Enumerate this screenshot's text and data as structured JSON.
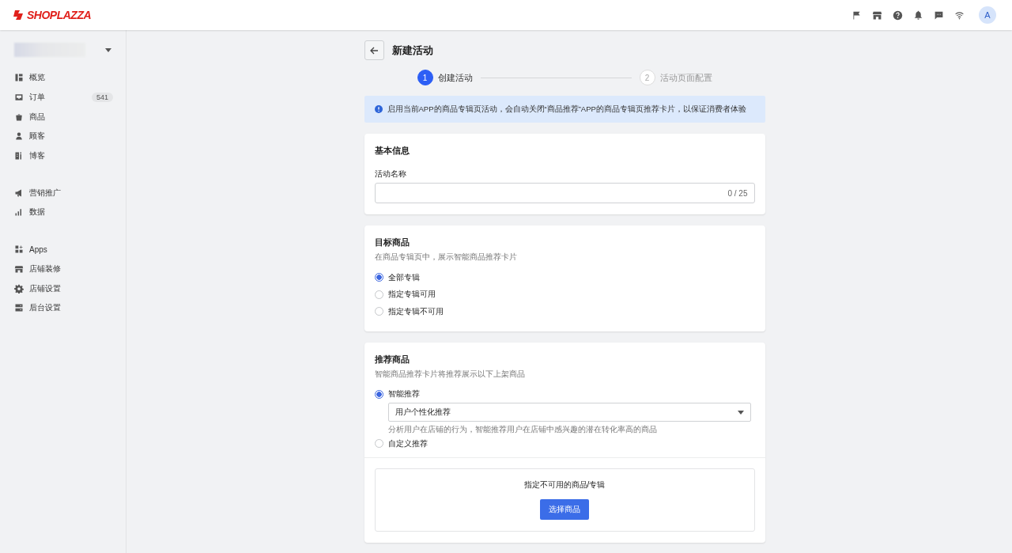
{
  "header": {
    "logo": "SHOPLAZZA",
    "avatar": "A"
  },
  "sidebar": {
    "groups": [
      [
        {
          "label": "概览"
        },
        {
          "label": "订单",
          "badge": "541"
        },
        {
          "label": "商品"
        },
        {
          "label": "顾客"
        },
        {
          "label": "博客"
        }
      ],
      [
        {
          "label": "营销推广"
        },
        {
          "label": "数据"
        }
      ],
      [
        {
          "label": "Apps"
        },
        {
          "label": "店铺装修"
        },
        {
          "label": "店铺设置"
        },
        {
          "label": "后台设置"
        }
      ]
    ]
  },
  "page": {
    "title": "新建活动",
    "steps": [
      {
        "number": "1",
        "label": "创建活动",
        "selected": true
      },
      {
        "number": "2",
        "label": "活动页面配置",
        "selected": false
      }
    ],
    "notice": "启用当前APP的商品专辑页活动，会自动关闭“商品推荐”APP的商品专辑页推荐卡片，以保证消费者体验",
    "basic": {
      "title": "基本信息",
      "field_label": "活动名称",
      "counter": "0 / 25"
    },
    "target": {
      "title": "目标商品",
      "subtitle": "在商品专辑页中，展示智能商品推荐卡片",
      "options": [
        {
          "label": "全部专辑",
          "selected": true
        },
        {
          "label": "指定专辑可用",
          "selected": false
        },
        {
          "label": "指定专辑不可用",
          "selected": false
        }
      ]
    },
    "recommend": {
      "title": "推荐商品",
      "subtitle": "智能商品推荐卡片将推荐展示以下上架商品",
      "options": [
        {
          "label": "智能推荐",
          "selected": true,
          "select_value": "用户个性化推荐",
          "hint": "分析用户在店铺的行为，智能推荐用户在店铺中感兴趣的潜在转化率高的商品"
        },
        {
          "label": "自定义推荐",
          "selected": false
        }
      ],
      "picker": {
        "title": "指定不可用的商品/专辑",
        "button": "选择商品"
      }
    }
  }
}
